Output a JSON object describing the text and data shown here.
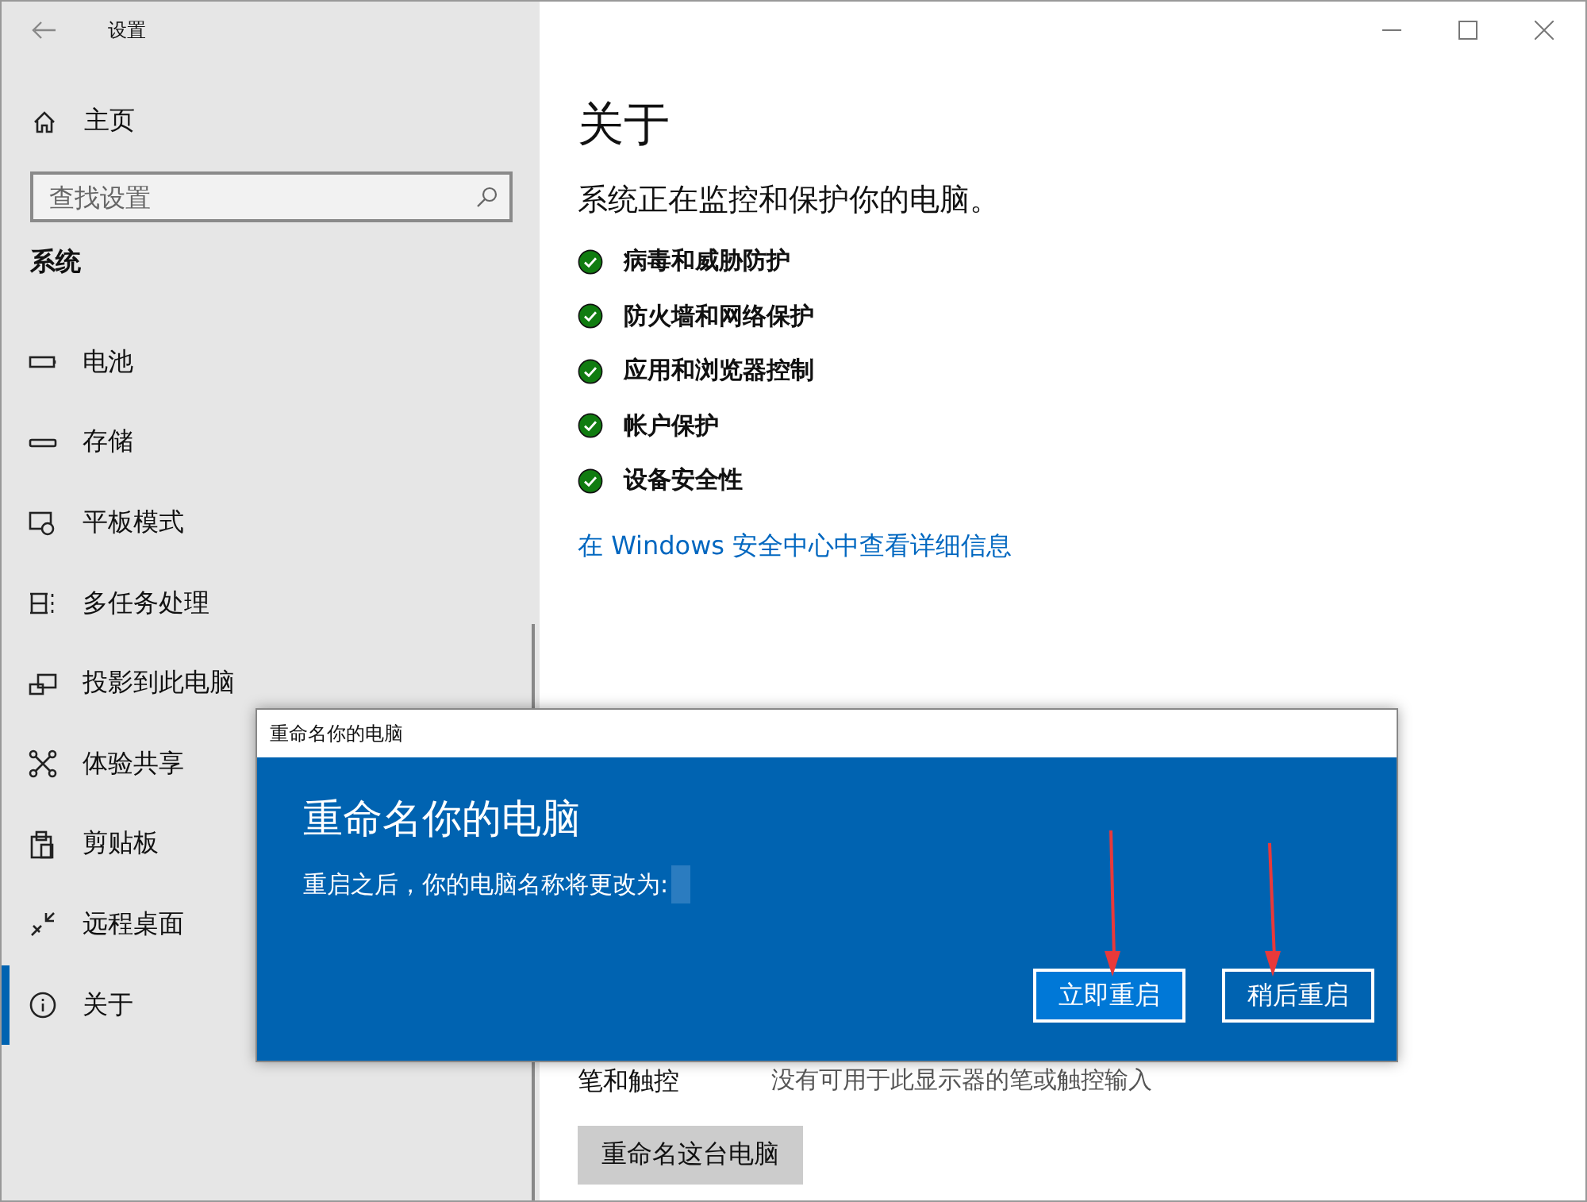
{
  "window": {
    "title": "设置"
  },
  "sidebar": {
    "home": "主页",
    "search": {
      "placeholder": "查找设置"
    },
    "section": "系统",
    "items": [
      {
        "label": "电池",
        "selected": false
      },
      {
        "label": "存储",
        "selected": false
      },
      {
        "label": "平板模式",
        "selected": false
      },
      {
        "label": "多任务处理",
        "selected": false
      },
      {
        "label": "投影到此电脑",
        "selected": false
      },
      {
        "label": "体验共享",
        "selected": false
      },
      {
        "label": "剪贴板",
        "selected": false
      },
      {
        "label": "远程桌面",
        "selected": false
      },
      {
        "label": "关于",
        "selected": true
      }
    ]
  },
  "main": {
    "title": "关于",
    "subtitle": "系统正在监控和保护你的电脑。",
    "protections": [
      {
        "label": "病毒和威胁防护",
        "ok": true
      },
      {
        "label": "防火墙和网络保护",
        "ok": true
      },
      {
        "label": "应用和浏览器控制",
        "ok": true
      },
      {
        "label": "帐户保护",
        "ok": true
      },
      {
        "label": "设备安全性",
        "ok": true
      }
    ],
    "link": "在 Windows 安全中心中查看详细信息",
    "pen_label": "笔和触控",
    "pen_value": "没有可用于此显示器的笔或触控输入",
    "rename_button": "重命名这台电脑"
  },
  "dialog": {
    "title": "重命名你的电脑",
    "heading": "重命名你的电脑",
    "message": "重启之后，你的电脑名称将更改为:",
    "buttons": [
      {
        "label": "立即重启",
        "selected": true
      },
      {
        "label": "稍后重启",
        "selected": false
      }
    ]
  }
}
